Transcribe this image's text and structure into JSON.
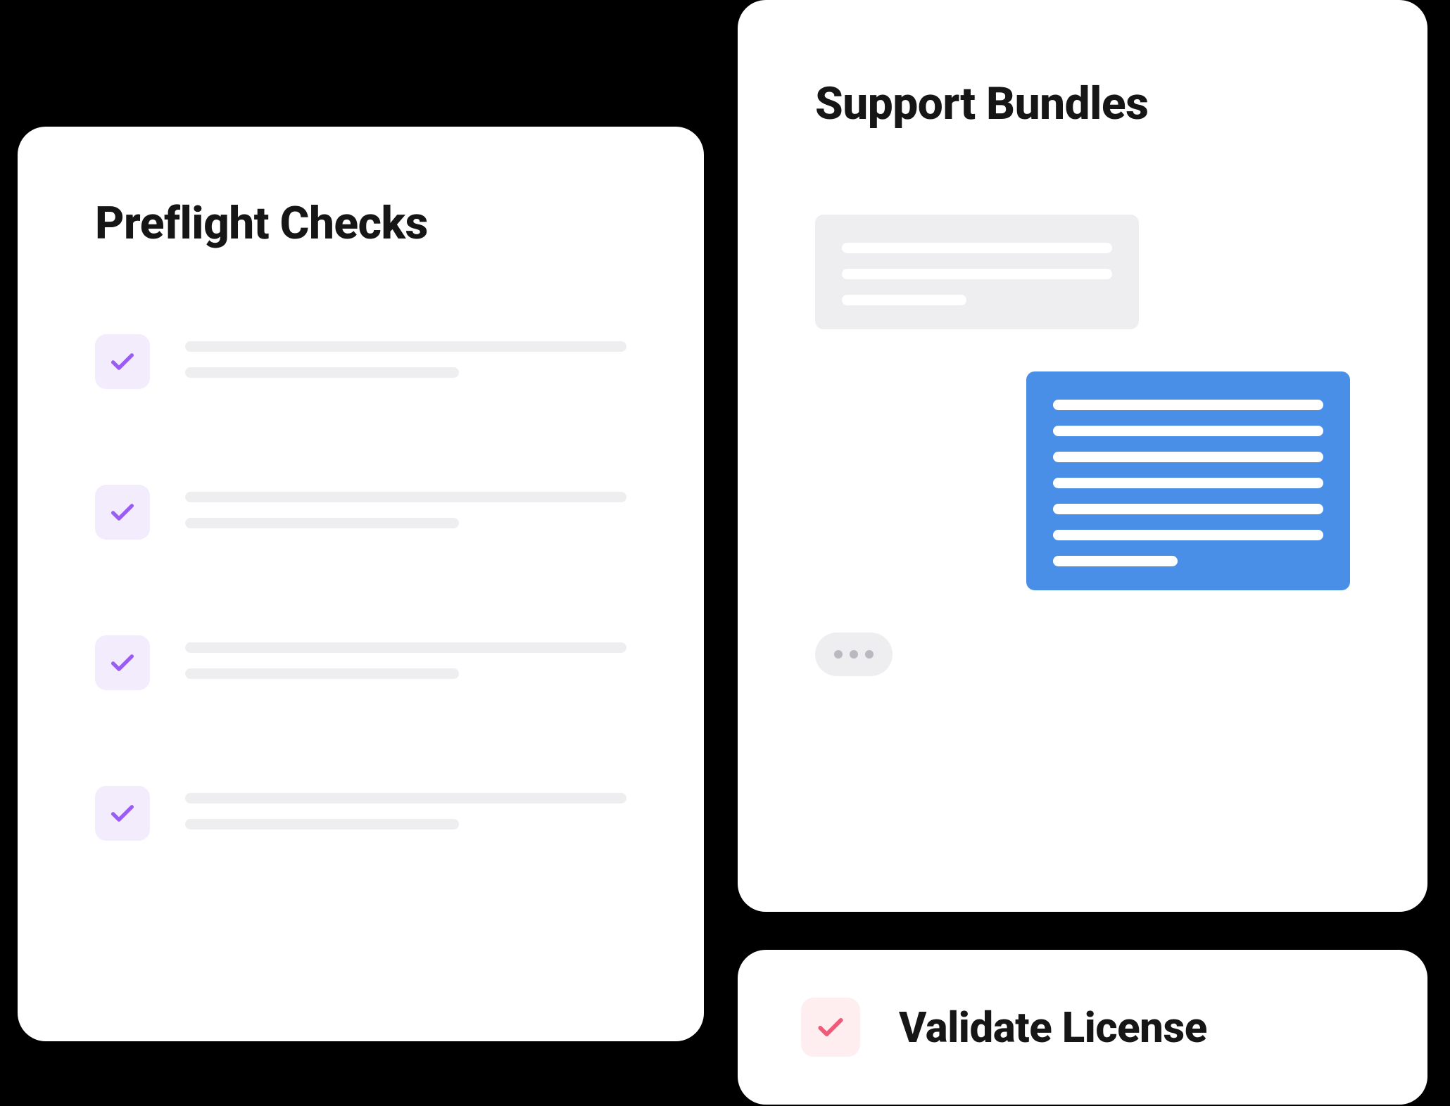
{
  "preflight": {
    "title": "Preflight Checks",
    "check_icon": "check-icon",
    "check_color": "#9b5cf6",
    "items": [
      {
        "id": "check-1"
      },
      {
        "id": "check-2"
      },
      {
        "id": "check-3"
      },
      {
        "id": "check-4"
      }
    ]
  },
  "support": {
    "title": "Support Bundles",
    "typing_icon": "typing-indicator"
  },
  "validate": {
    "title": "Validate License",
    "check_icon": "check-icon",
    "check_color": "#ef5a78"
  },
  "colors": {
    "purple_light": "#f2ecfd",
    "purple": "#9b5cf6",
    "grey": "#eeeef0",
    "blue": "#4a8fe7",
    "pink_light": "#ffeef0",
    "pink": "#ef5a78"
  }
}
